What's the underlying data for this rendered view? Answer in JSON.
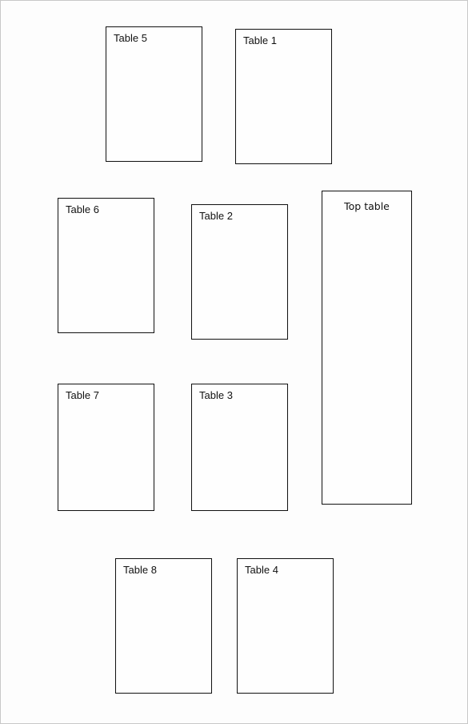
{
  "diagram": {
    "type": "seating-plan",
    "tables": [
      {
        "id": "table-5",
        "label": "Table 5"
      },
      {
        "id": "table-1",
        "label": "Table 1"
      },
      {
        "id": "table-6",
        "label": "Table 6"
      },
      {
        "id": "table-2",
        "label": "Table 2"
      },
      {
        "id": "top-table",
        "label": "Top table"
      },
      {
        "id": "table-7",
        "label": "Table 7"
      },
      {
        "id": "table-3",
        "label": "Table 3"
      },
      {
        "id": "table-8",
        "label": "Table 8"
      },
      {
        "id": "table-4",
        "label": "Table 4"
      }
    ]
  }
}
